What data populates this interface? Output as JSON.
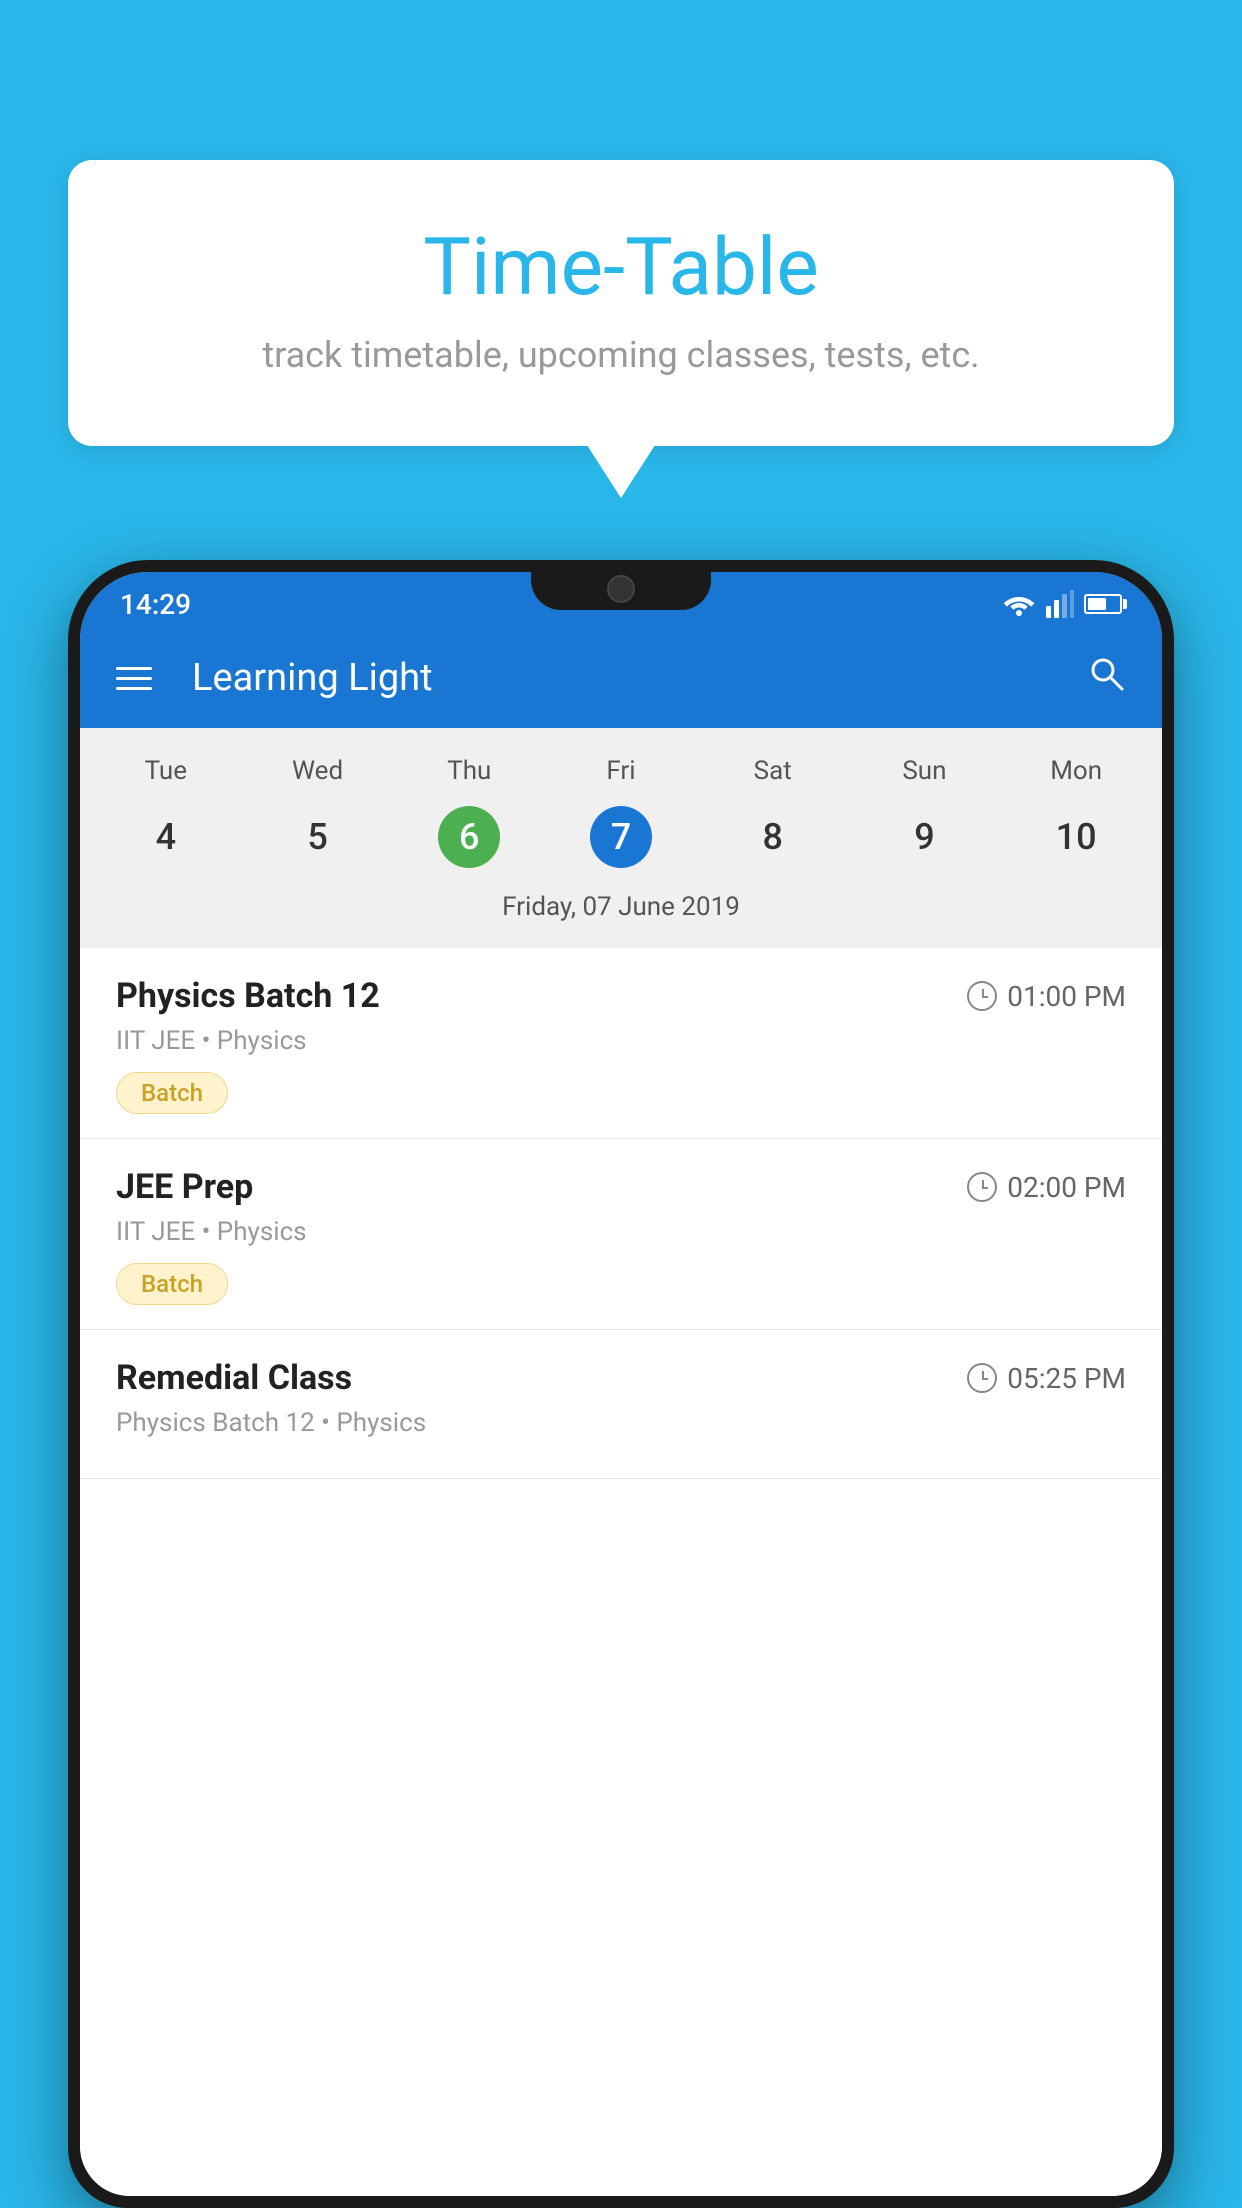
{
  "background_color": "#29B6E8",
  "tooltip": {
    "title": "Time-Table",
    "subtitle": "track timetable, upcoming classes, tests, etc."
  },
  "app": {
    "status_time": "14:29",
    "title": "Learning Light",
    "menu_icon": "hamburger-icon",
    "search_icon": "search-icon"
  },
  "calendar": {
    "days": [
      "Tue",
      "Wed",
      "Thu",
      "Fri",
      "Sat",
      "Sun",
      "Mon"
    ],
    "dates": [
      "4",
      "5",
      "6",
      "7",
      "8",
      "9",
      "10"
    ],
    "today_index": 2,
    "selected_index": 3,
    "selected_label": "Friday, 07 June 2019"
  },
  "schedule": [
    {
      "title": "Physics Batch 12",
      "time": "01:00 PM",
      "meta": "IIT JEE • Physics",
      "badge": "Batch"
    },
    {
      "title": "JEE Prep",
      "time": "02:00 PM",
      "meta": "IIT JEE • Physics",
      "badge": "Batch"
    },
    {
      "title": "Remedial Class",
      "time": "05:25 PM",
      "meta": "Physics Batch 12 • Physics",
      "badge": null
    }
  ]
}
